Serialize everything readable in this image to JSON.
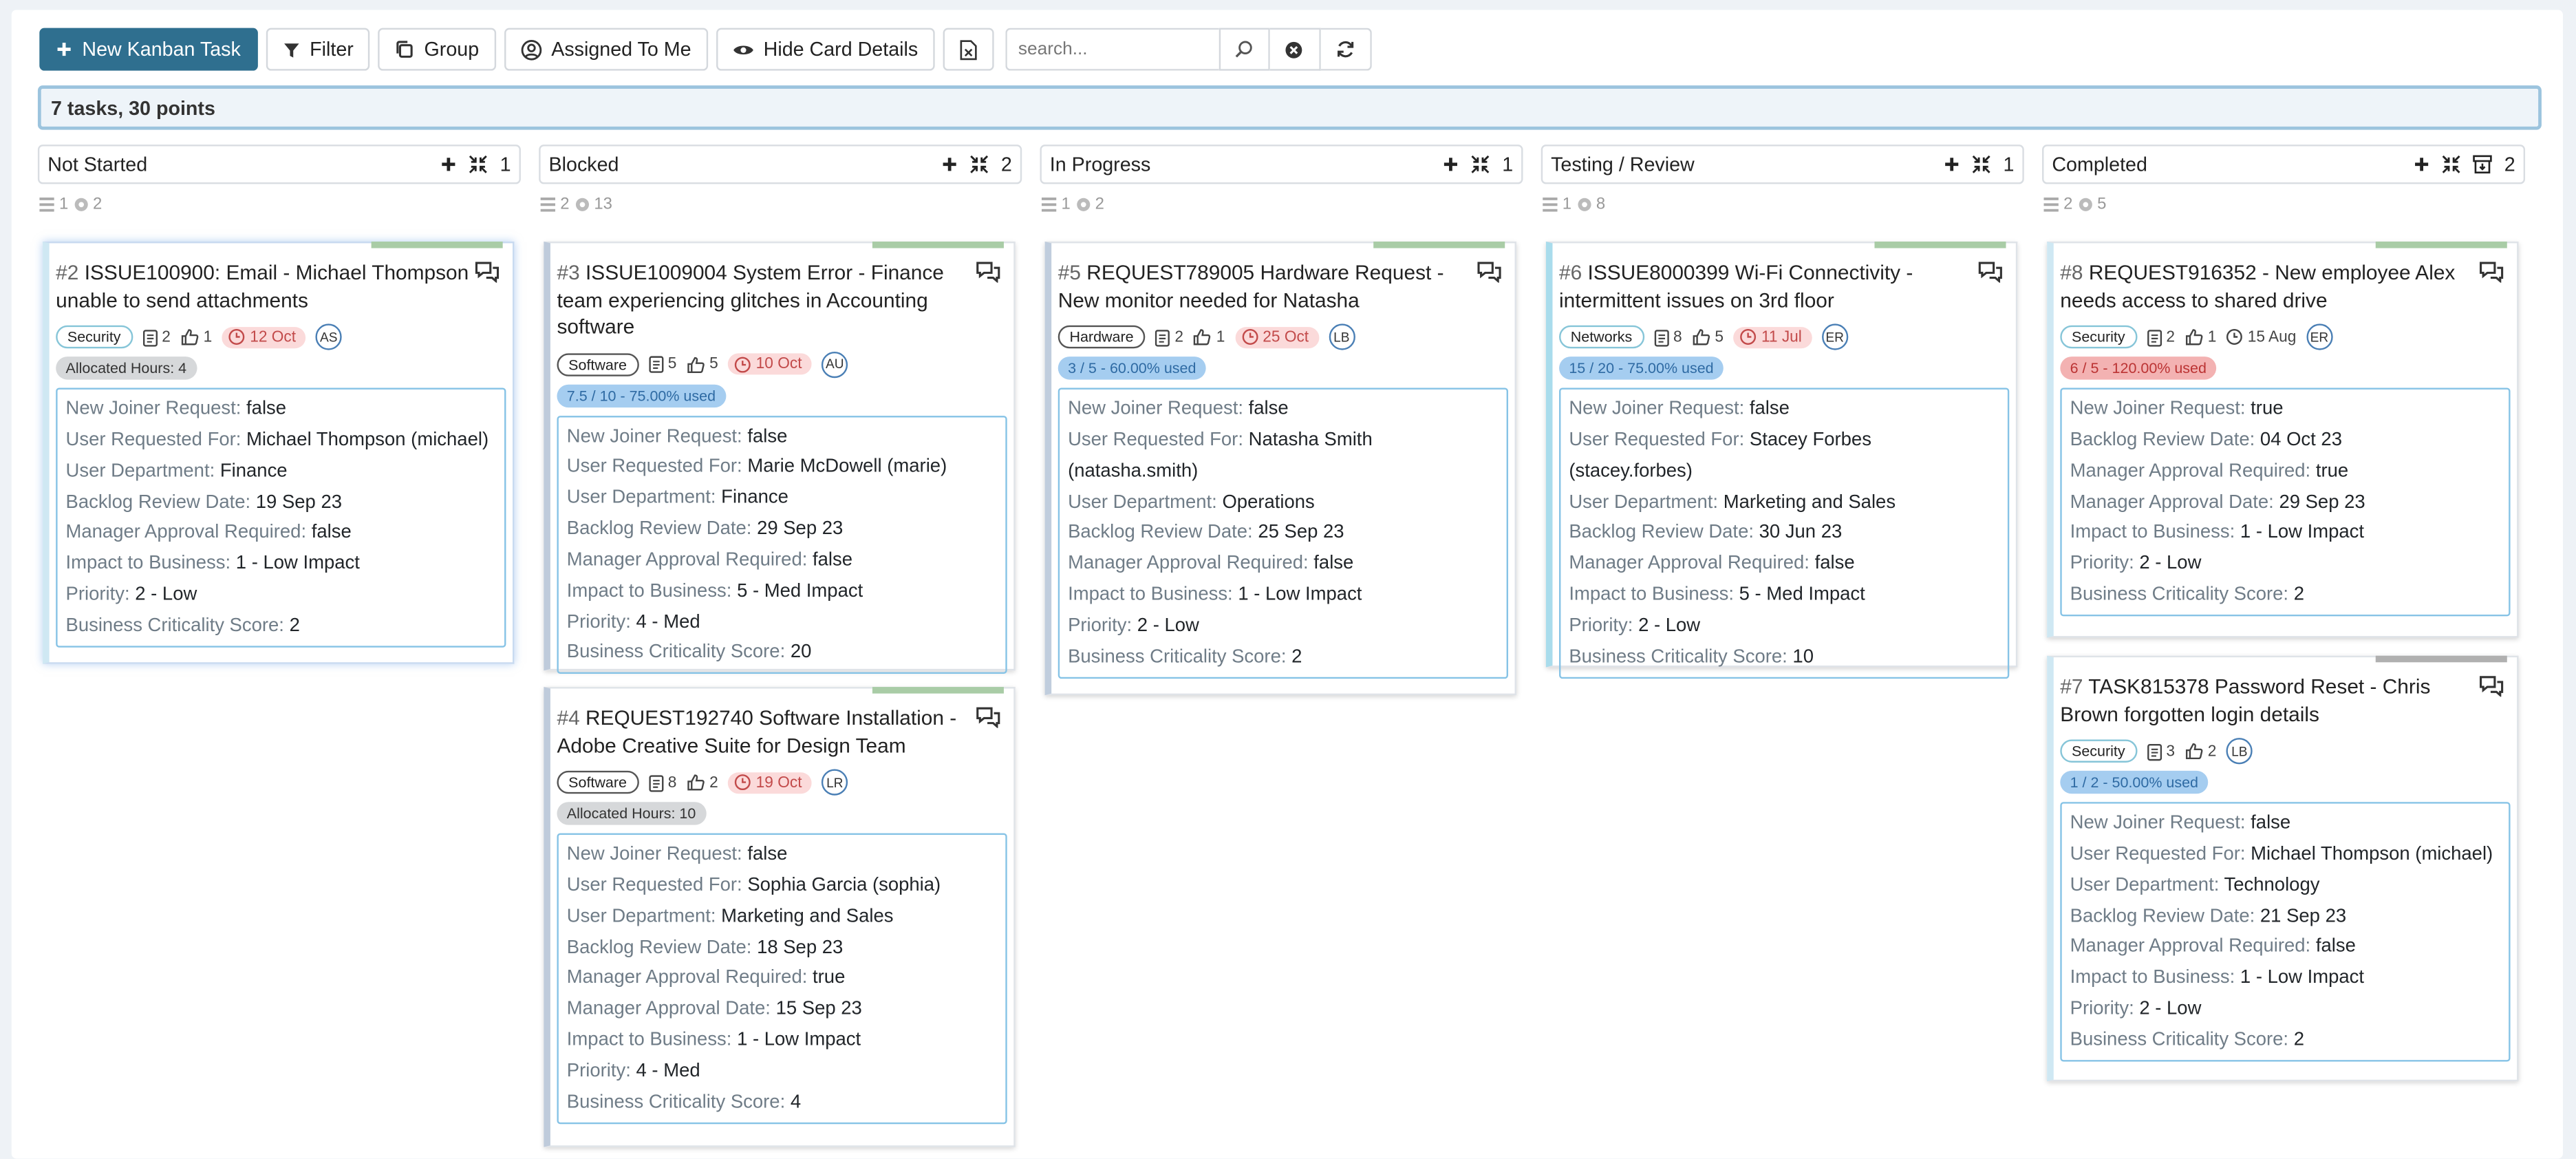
{
  "toolbar": {
    "new_task": "New Kanban Task",
    "filter": "Filter",
    "group": "Group",
    "assigned": "Assigned To Me",
    "hide_details": "Hide Card Details",
    "search_placeholder": "search..."
  },
  "summary": "7 tasks, 30 points",
  "columns": [
    {
      "title": "Not Started",
      "count": "1",
      "stat_a": "1",
      "stat_b": "2"
    },
    {
      "title": "Blocked",
      "count": "2",
      "stat_a": "2",
      "stat_b": "13"
    },
    {
      "title": "In Progress",
      "count": "1",
      "stat_a": "1",
      "stat_b": "2"
    },
    {
      "title": "Testing / Review",
      "count": "1",
      "stat_a": "1",
      "stat_b": "8"
    },
    {
      "title": "Completed",
      "count": "2",
      "stat_a": "2",
      "stat_b": "5"
    }
  ],
  "cards": {
    "c2": {
      "num": "#2",
      "title": "ISSUE100900: Email - Michael Thompson unable to send attachments",
      "tag": "Security",
      "points": "2",
      "likes": "1",
      "due": "12 Oct",
      "avatar": "AS",
      "pill": "Allocated Hours: 4",
      "details": [
        {
          "k": "New Joiner Request:",
          "v": "false"
        },
        {
          "k": "User Requested For:",
          "v": "Michael Thompson (michael)"
        },
        {
          "k": "User Department:",
          "v": "Finance"
        },
        {
          "k": "Backlog Review Date:",
          "v": "19 Sep 23"
        },
        {
          "k": "Manager Approval Required:",
          "v": "false"
        },
        {
          "k": "Impact to Business:",
          "v": "1 - Low Impact"
        },
        {
          "k": "Priority:",
          "v": "2 - Low"
        },
        {
          "k": "Business Criticality Score:",
          "v": "2"
        }
      ]
    },
    "c3": {
      "num": "#3",
      "title": "ISSUE1009004 System Error - Finance team experiencing glitches in Accounting software",
      "tag": "Software",
      "points": "5",
      "likes": "5",
      "due": "10 Oct",
      "avatar": "AU",
      "pill": "7.5 / 10 - 75.00% used",
      "details": [
        {
          "k": "New Joiner Request:",
          "v": "false"
        },
        {
          "k": "User Requested For:",
          "v": "Marie McDowell (marie)"
        },
        {
          "k": "User Department:",
          "v": "Finance"
        },
        {
          "k": "Backlog Review Date:",
          "v": "29 Sep 23"
        },
        {
          "k": "Manager Approval Required:",
          "v": "false"
        },
        {
          "k": "Impact to Business:",
          "v": "5 - Med Impact"
        },
        {
          "k": "Priority:",
          "v": "4 - Med"
        },
        {
          "k": "Business Criticality Score:",
          "v": "20"
        }
      ]
    },
    "c4": {
      "num": "#4",
      "title": "REQUEST192740 Software Installation - Adobe Creative Suite for Design Team",
      "tag": "Software",
      "points": "8",
      "likes": "2",
      "due": "19 Oct",
      "avatar": "LR",
      "pill": "Allocated Hours: 10",
      "details": [
        {
          "k": "New Joiner Request:",
          "v": "false"
        },
        {
          "k": "User Requested For:",
          "v": "Sophia Garcia (sophia)"
        },
        {
          "k": "User Department:",
          "v": "Marketing and Sales"
        },
        {
          "k": "Backlog Review Date:",
          "v": "18 Sep 23"
        },
        {
          "k": "Manager Approval Required:",
          "v": "true"
        },
        {
          "k": "Manager Approval Date:",
          "v": "15 Sep 23"
        },
        {
          "k": "Impact to Business:",
          "v": "1 - Low Impact"
        },
        {
          "k": "Priority:",
          "v": "4 - Med"
        },
        {
          "k": "Business Criticality Score:",
          "v": "4"
        }
      ]
    },
    "c5": {
      "num": "#5",
      "title": "REQUEST789005 Hardware Request - New monitor needed for Natasha",
      "tag": "Hardware",
      "points": "2",
      "likes": "1",
      "due": "25 Oct",
      "avatar": "LB",
      "pill": "3 / 5 - 60.00% used",
      "details": [
        {
          "k": "New Joiner Request:",
          "v": "false"
        },
        {
          "k": "User Requested For:",
          "v": "Natasha Smith (natasha.smith)"
        },
        {
          "k": "User Department:",
          "v": "Operations"
        },
        {
          "k": "Backlog Review Date:",
          "v": "25 Sep 23"
        },
        {
          "k": "Manager Approval Required:",
          "v": "false"
        },
        {
          "k": "Impact to Business:",
          "v": "1 - Low Impact"
        },
        {
          "k": "Priority:",
          "v": "2 - Low"
        },
        {
          "k": "Business Criticality Score:",
          "v": "2"
        }
      ]
    },
    "c6": {
      "num": "#6",
      "title": "ISSUE8000399 Wi-Fi Connectivity - intermittent issues on 3rd floor",
      "tag": "Networks",
      "points": "8",
      "likes": "5",
      "due": "11 Jul",
      "avatar": "ER",
      "pill": "15 / 20 - 75.00% used",
      "details": [
        {
          "k": "New Joiner Request:",
          "v": "false"
        },
        {
          "k": "User Requested For:",
          "v": "Stacey Forbes (stacey.forbes)"
        },
        {
          "k": "User Department:",
          "v": "Marketing and Sales"
        },
        {
          "k": "Backlog Review Date:",
          "v": "30 Jun 23"
        },
        {
          "k": "Manager Approval Required:",
          "v": "false"
        },
        {
          "k": "Impact to Business:",
          "v": "5 - Med Impact"
        },
        {
          "k": "Priority:",
          "v": "2 - Low"
        },
        {
          "k": "Business Criticality Score:",
          "v": "10"
        }
      ]
    },
    "c8": {
      "num": "#8",
      "title": "REQUEST916352 - New employee Alex needs access to shared drive",
      "tag": "Security",
      "points": "2",
      "likes": "1",
      "due": "15 Aug",
      "avatar": "ER",
      "pill": "6 / 5 - 120.00% used",
      "details": [
        {
          "k": "New Joiner Request:",
          "v": "true"
        },
        {
          "k": "Backlog Review Date:",
          "v": "04 Oct 23"
        },
        {
          "k": "Manager Approval Required:",
          "v": "true"
        },
        {
          "k": "Manager Approval Date:",
          "v": "29 Sep 23"
        },
        {
          "k": "Impact to Business:",
          "v": "1 - Low Impact"
        },
        {
          "k": "Priority:",
          "v": "2 - Low"
        },
        {
          "k": "Business Criticality Score:",
          "v": "2"
        }
      ]
    },
    "c7": {
      "num": "#7",
      "title": "TASK815378 Password Reset - Chris Brown forgotten login details",
      "tag": "Security",
      "points": "3",
      "likes": "2",
      "avatar": "LB",
      "pill": "1 / 2 - 50.00% used",
      "details": [
        {
          "k": "New Joiner Request:",
          "v": "false"
        },
        {
          "k": "User Requested For:",
          "v": "Michael Thompson (michael)"
        },
        {
          "k": "User Department:",
          "v": "Technology"
        },
        {
          "k": "Backlog Review Date:",
          "v": "21 Sep 23"
        },
        {
          "k": "Manager Approval Required:",
          "v": "false"
        },
        {
          "k": "Impact to Business:",
          "v": "1 - Low Impact"
        },
        {
          "k": "Priority:",
          "v": "2 - Low"
        },
        {
          "k": "Business Criticality Score:",
          "v": "2"
        }
      ]
    }
  }
}
